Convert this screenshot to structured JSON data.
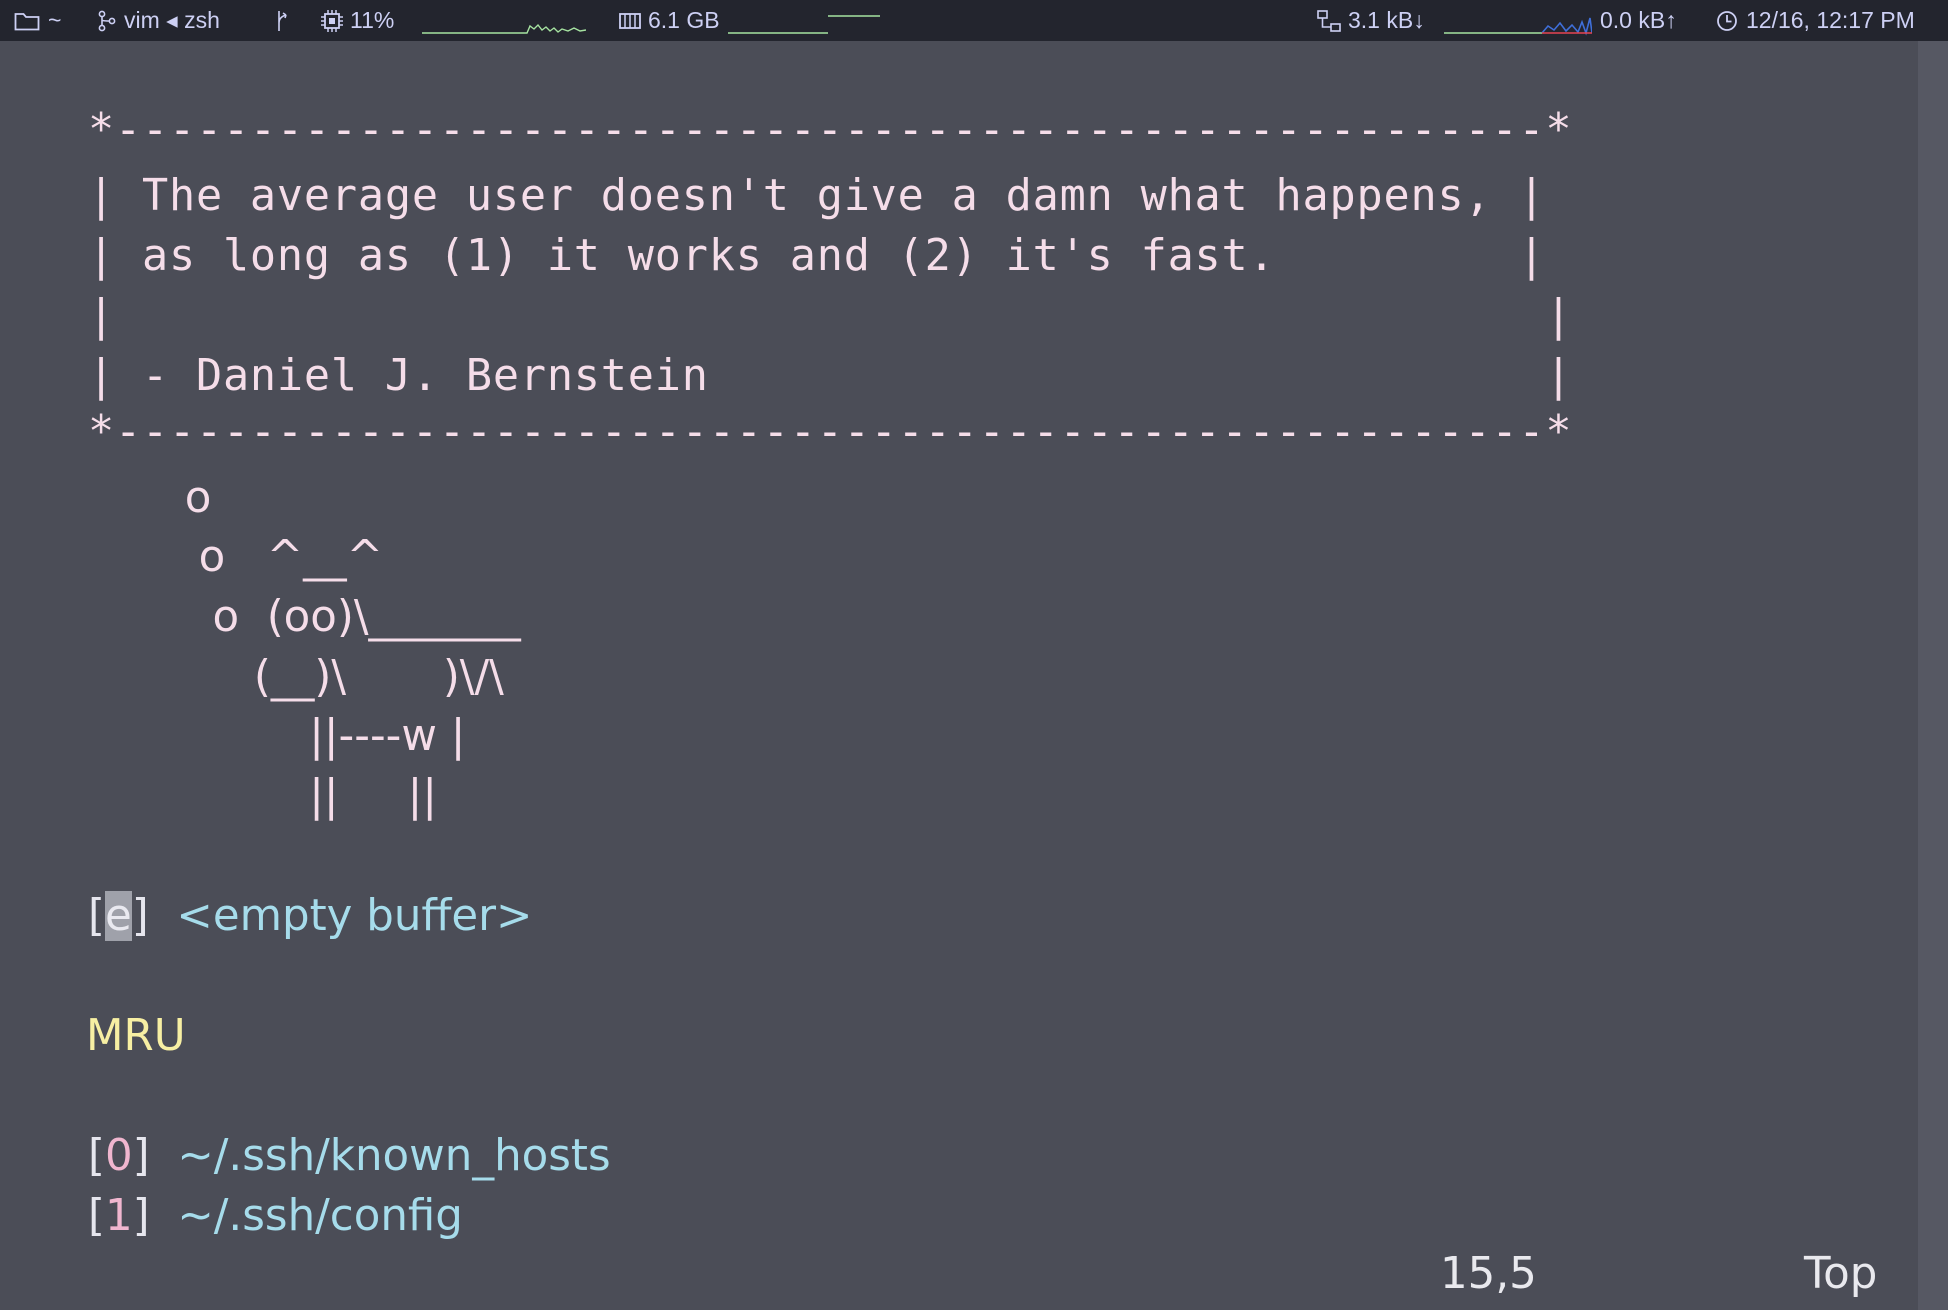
{
  "topbar": {
    "cwd": "~",
    "process": "vim ◂ zsh",
    "cpu": "11%",
    "memory": "6.1 GB",
    "net_down": "3.1 kB↓",
    "net_up": "0.0 kB↑",
    "datetime": "12/16, 12:17 PM",
    "icons": [
      "folder-icon",
      "git-branch-icon",
      "git-fork-icon",
      "cpu-chip-icon",
      "memory-icon",
      "network-icon",
      "clock-icon"
    ]
  },
  "editor": {
    "fortune_box": [
      "*-----------------------------------------------------*",
      "| The average user doesn't give a damn what happens, |",
      "| as long as (1) it works and (2) it's fast.         |",
      "|                                                     |",
      "| - Daniel J. Bernstein                               |",
      "*-----------------------------------------------------*"
    ],
    "cow": [
      "       o",
      "        o   ^__^",
      "         o  (oo)\\_______",
      "            (__)\\       )\\/\\",
      "                ||----w |",
      "                ||     ||"
    ],
    "empty_buffer": {
      "bracket_open": "[",
      "key": "e",
      "bracket_close": "]",
      "label": "<empty buffer>"
    },
    "mru_heading": "MRU",
    "mru_items": [
      {
        "bracket_open": "[",
        "key": "0",
        "bracket_close": "]",
        "dir": "~/.ssh/",
        "file": "known_hosts"
      },
      {
        "bracket_open": "[",
        "key": "1",
        "bracket_close": "]",
        "dir": "~/.ssh/",
        "file": "config"
      }
    ],
    "ruler": {
      "position": "15,5",
      "scroll": "Top"
    }
  },
  "colors": {
    "background": "#4b4d57",
    "topbar": "#23252e",
    "text": "#f5dde9",
    "accent_pink": "#f0b6cf",
    "accent_cyan": "#a6dceb",
    "accent_yellow": "#f7efa3",
    "spark_green": "#a6e3a1",
    "spark_red": "#e64553",
    "spark_blue": "#3f6fd9"
  }
}
